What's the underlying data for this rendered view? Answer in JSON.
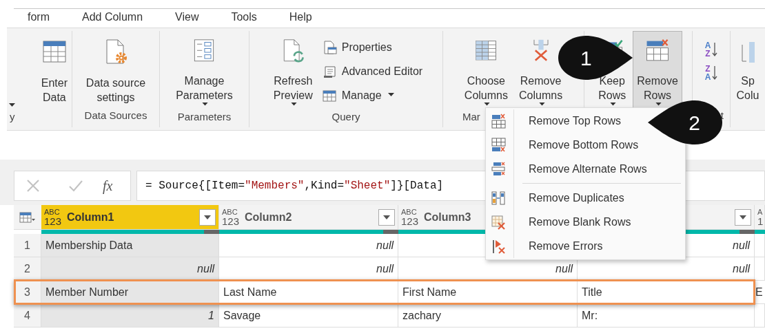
{
  "menu_tabs": [
    {
      "label": "form"
    },
    {
      "label": "Add Column"
    },
    {
      "label": "View"
    },
    {
      "label": "Tools"
    },
    {
      "label": "Help"
    }
  ],
  "ribbon_groups": [
    {
      "label": "y",
      "buttons": [
        {
          "kind": "caret",
          "dropdown": true
        },
        {
          "kind": "large",
          "lines": [
            "Enter",
            "Data"
          ],
          "dropdown": false,
          "pressed": false
        }
      ]
    },
    {
      "label": "Data Sources",
      "buttons": [
        {
          "kind": "large",
          "lines": [
            "Data source",
            "settings"
          ],
          "dropdown": false,
          "pressed": false
        }
      ]
    },
    {
      "label": "Parameters",
      "buttons": [
        {
          "kind": "large",
          "lines": [
            "Manage",
            "Parameters"
          ],
          "dropdown": true,
          "pressed": false
        }
      ]
    },
    {
      "label": "Query",
      "buttons": [
        {
          "kind": "large",
          "lines": [
            "Refresh",
            "Preview"
          ],
          "dropdown": true,
          "pressed": false
        },
        {
          "kind": "small",
          "label": "Properties",
          "dropdown": false
        },
        {
          "kind": "small",
          "label": "Advanced Editor",
          "dropdown": false
        },
        {
          "kind": "small",
          "label": "Manage",
          "dropdown": true
        }
      ]
    },
    {
      "label": "Mar",
      "buttons": [
        {
          "kind": "large",
          "lines": [
            "Choose",
            "Columns"
          ],
          "dropdown": true,
          "pressed": false
        },
        {
          "kind": "large",
          "lines": [
            "Remove",
            "Columns"
          ],
          "dropdown": true,
          "pressed": false
        }
      ]
    },
    {
      "buttons": [
        {
          "kind": "large",
          "lines": [
            "Keep",
            "Rows"
          ],
          "dropdown": true,
          "pressed": false
        },
        {
          "kind": "large",
          "lines": [
            "Remove",
            "Rows"
          ],
          "dropdown": true,
          "pressed": true
        }
      ]
    },
    {
      "label": "t",
      "buttons": [
        {
          "kind": "sort",
          "top": "A",
          "bottom": "Z"
        },
        {
          "kind": "sort",
          "top": "Z",
          "bottom": "A"
        }
      ]
    },
    {
      "buttons": [
        {
          "kind": "large",
          "lines": [
            "Sp",
            "Colu"
          ],
          "dropdown": false,
          "pressed": false
        }
      ]
    }
  ],
  "remove_rows_menu": [
    {
      "kind": "item",
      "label": "Remove Top Rows"
    },
    {
      "kind": "item",
      "label": "Remove Bottom Rows"
    },
    {
      "kind": "item",
      "label": "Remove Alternate Rows"
    },
    {
      "kind": "separator"
    },
    {
      "kind": "item",
      "label": "Remove Duplicates"
    },
    {
      "kind": "item",
      "label": "Remove Blank Rows"
    },
    {
      "kind": "item",
      "label": "Remove Errors"
    }
  ],
  "callouts": [
    {
      "label": "1"
    },
    {
      "label": "2"
    }
  ],
  "formula_bar": {
    "function_button": "fx",
    "formula": [
      {
        "kind": "code",
        "text": "= Source{[Item="
      },
      {
        "kind": "string",
        "text": "\"Members\""
      },
      {
        "kind": "code",
        "text": ",Kind="
      },
      {
        "kind": "string",
        "text": "\"Sheet\""
      },
      {
        "kind": "code",
        "text": "]}[Data]"
      }
    ]
  },
  "table": {
    "columns": [
      {
        "name": "Column1",
        "type": [
          "ABC",
          "123"
        ],
        "selected": true
      },
      {
        "name": "Column2",
        "type": [
          "ABC",
          "123"
        ],
        "selected": false
      },
      {
        "name": "Column3",
        "type": [
          "ABC",
          "123"
        ],
        "selected": false
      },
      {
        "selected": false
      },
      {
        "type": [
          "A",
          "1"
        ],
        "selected": false
      }
    ],
    "rows": [
      {
        "number": "1",
        "highlighted": false,
        "cells": [
          {
            "kind": "text",
            "text": "Membership Data"
          },
          {
            "kind": "null",
            "text": "null"
          },
          {
            "kind": "empty"
          },
          {
            "kind": "null",
            "text": "null"
          },
          {
            "kind": "empty"
          }
        ]
      },
      {
        "number": "2",
        "highlighted": false,
        "cells": [
          {
            "kind": "null",
            "text": "null"
          },
          {
            "kind": "null",
            "text": "null"
          },
          {
            "kind": "null",
            "text": "null"
          },
          {
            "kind": "null",
            "text": "null"
          },
          {
            "kind": "empty"
          }
        ]
      },
      {
        "number": "3",
        "highlighted": true,
        "cells": [
          {
            "kind": "text",
            "text": "Member Number"
          },
          {
            "kind": "text",
            "text": "Last Name"
          },
          {
            "kind": "text",
            "text": "First Name"
          },
          {
            "kind": "text",
            "text": "Title"
          },
          {
            "kind": "text",
            "text": "E"
          }
        ]
      },
      {
        "number": "4",
        "highlighted": false,
        "cells": [
          {
            "kind": "number",
            "text": "1"
          },
          {
            "kind": "text",
            "text": "Savage"
          },
          {
            "kind": "text",
            "text": "zachary"
          },
          {
            "kind": "text",
            "text": "Mr:"
          },
          {
            "kind": "empty"
          }
        ]
      }
    ]
  }
}
